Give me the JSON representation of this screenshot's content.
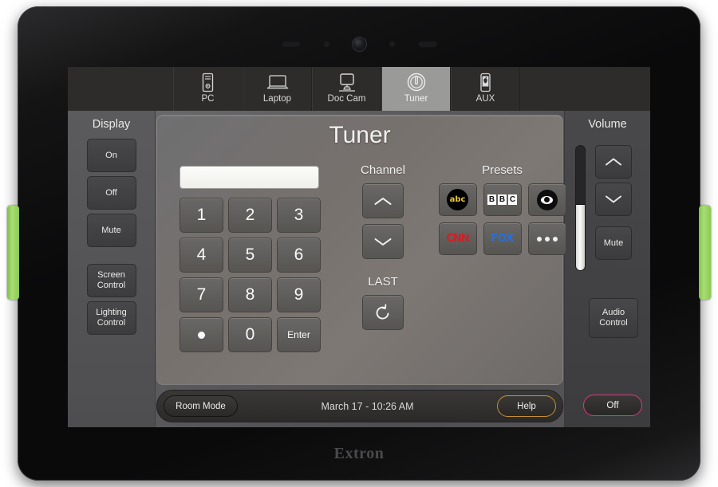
{
  "device": {
    "brand": "Extron",
    "hardware": {
      "speaker_left": "speaker-grille",
      "speaker_right": "speaker-grille",
      "camera": "front-camera",
      "sensor_left": "sensor-dot",
      "sensor_right": "sensor-dot"
    },
    "side_tab_color": "#8cc857"
  },
  "source_bar": {
    "tabs": [
      {
        "label": "PC",
        "icon": "desktop-tower-icon",
        "active": false
      },
      {
        "label": "Laptop",
        "icon": "laptop-icon",
        "active": false
      },
      {
        "label": "Doc Cam",
        "icon": "document-camera-icon",
        "active": false
      },
      {
        "label": "Tuner",
        "icon": "power-knob-icon",
        "active": true
      },
      {
        "label": "AUX",
        "icon": "mobile-device-icon",
        "active": false
      }
    ]
  },
  "display_rail": {
    "title": "Display",
    "buttons": [
      {
        "label": "On"
      },
      {
        "label": "Off"
      },
      {
        "label": "Mute"
      },
      {
        "label": "Screen\nControl",
        "line1": "Screen",
        "line2": "Control"
      },
      {
        "label": "Lighting\nControl",
        "line1": "Lighting",
        "line2": "Control"
      }
    ]
  },
  "volume_rail": {
    "title": "Volume",
    "slider": {
      "name": "volume-slider",
      "level_percent": 53
    },
    "up_icon": "chevron-up-icon",
    "down_icon": "chevron-down-icon",
    "mute_label": "Mute",
    "audio_control": {
      "line1": "Audio",
      "line2": "Control"
    }
  },
  "panel": {
    "title": "Tuner",
    "channel_entry": {
      "value": "",
      "placeholder": ""
    },
    "keypad": [
      {
        "label": "1",
        "type": "digit"
      },
      {
        "label": "2",
        "type": "digit"
      },
      {
        "label": "3",
        "type": "digit"
      },
      {
        "label": "4",
        "type": "digit"
      },
      {
        "label": "5",
        "type": "digit"
      },
      {
        "label": "6",
        "type": "digit"
      },
      {
        "label": "7",
        "type": "digit"
      },
      {
        "label": "8",
        "type": "digit"
      },
      {
        "label": "9",
        "type": "digit"
      },
      {
        "label": "",
        "type": "dot",
        "icon": "dot-icon"
      },
      {
        "label": "0",
        "type": "digit"
      },
      {
        "label": "Enter",
        "type": "enter"
      }
    ],
    "channel": {
      "title": "Channel",
      "up_icon": "chevron-up-icon",
      "down_icon": "chevron-down-icon"
    },
    "last": {
      "title": "LAST",
      "icon": "rotate-counterclockwise-icon"
    },
    "presets": {
      "title": "Presets",
      "items": [
        {
          "name": "preset-abc",
          "logo": "abc-logo",
          "text": "abc"
        },
        {
          "name": "preset-bbc",
          "logo": "bbc-logo",
          "letters": [
            "B",
            "B",
            "C"
          ]
        },
        {
          "name": "preset-cbs",
          "logo": "cbs-eye-logo"
        },
        {
          "name": "preset-cnn",
          "logo": "cnn-logo",
          "text": "CNN"
        },
        {
          "name": "preset-fox",
          "logo": "fox-logo",
          "text": "FOX"
        },
        {
          "name": "preset-more",
          "logo": "ellipsis-icon"
        }
      ]
    }
  },
  "bottom_bar": {
    "room_mode_label": "Room Mode",
    "datetime": "March 17  - 10:26 AM",
    "help_label": "Help",
    "off_label": "Off",
    "help_accent": "#c6912f",
    "off_accent": "#cf3f7a"
  }
}
